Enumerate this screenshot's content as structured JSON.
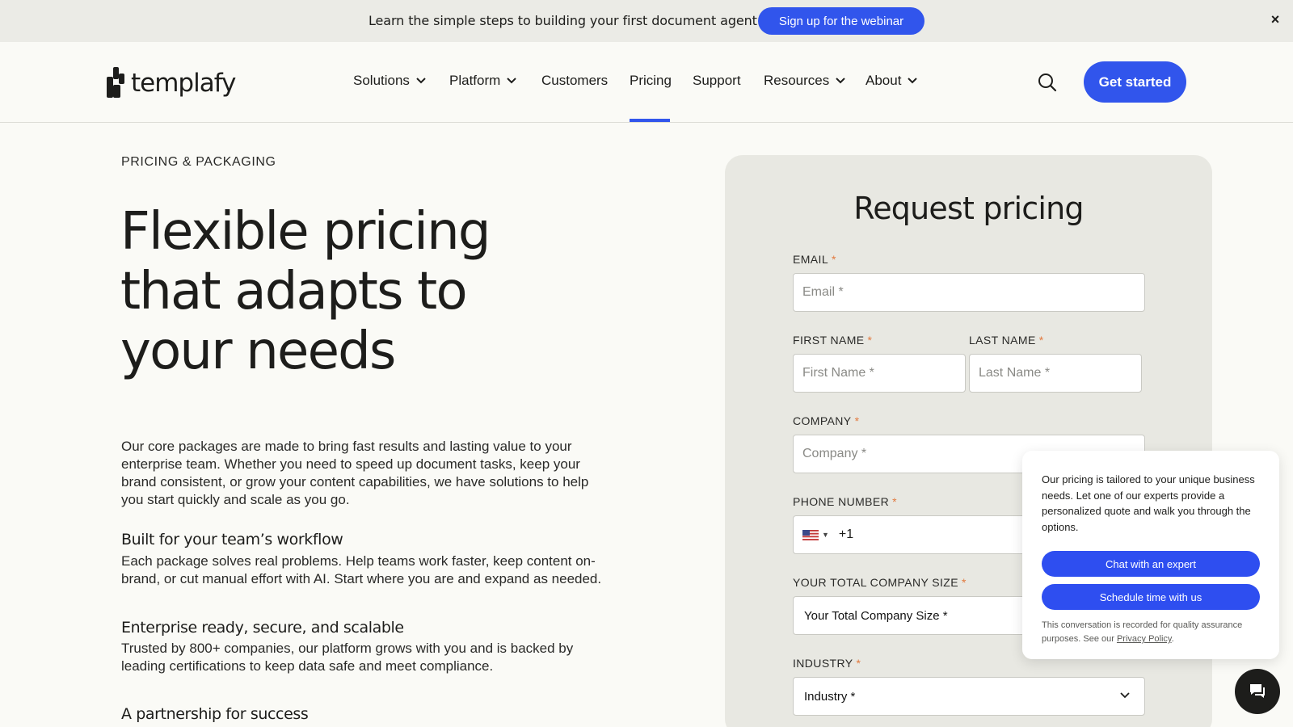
{
  "announcement": {
    "text": "Learn the simple steps to building your first document agent",
    "button_label": "Sign up for the webinar",
    "close_glyph": "×"
  },
  "header": {
    "logo_text": "templafy",
    "nav": [
      {
        "label": "Solutions",
        "has_dropdown": true
      },
      {
        "label": "Platform",
        "has_dropdown": true
      },
      {
        "label": "Customers",
        "has_dropdown": false
      },
      {
        "label": "Pricing",
        "has_dropdown": false,
        "active": true
      },
      {
        "label": "Support",
        "has_dropdown": false
      },
      {
        "label": "Resources",
        "has_dropdown": true
      },
      {
        "label": "About",
        "has_dropdown": true
      }
    ],
    "search_icon": "search-icon",
    "cta_label": "Get started"
  },
  "main": {
    "eyebrow": "PRICING & PACKAGING",
    "hero_line1": "Flexible pricing",
    "hero_line2": "that adapts to",
    "hero_line3": "your needs",
    "intro": "Our core packages are made to bring fast results and lasting value to your enterprise team. Whether you need to speed up document tasks, keep your brand consistent, or grow your content capabilities, we have solutions to help you start quickly and scale as you go.",
    "features": [
      {
        "title": "Built for your team’s workflow",
        "body": "Each package solves real problems. Help teams work faster, keep content on-brand, or cut manual effort with AI. Start where you are and expand as needed."
      },
      {
        "title": "Enterprise ready, secure, and scalable",
        "body": "Trusted by 800+ companies, our platform grows with you and is backed by leading certifications to keep data safe and meet compliance."
      },
      {
        "title": "A partnership for success",
        "body": ""
      }
    ]
  },
  "form": {
    "title": "Request pricing",
    "required_mark": "*",
    "email": {
      "label": "EMAIL",
      "placeholder": "Email *"
    },
    "first_name": {
      "label": "FIRST NAME",
      "placeholder": "First Name *"
    },
    "last_name": {
      "label": "LAST NAME",
      "placeholder": "Last Name *"
    },
    "company": {
      "label": "COMPANY",
      "placeholder": "Company *"
    },
    "phone": {
      "label": "PHONE NUMBER",
      "dial_code": "+1",
      "country": "US"
    },
    "company_size": {
      "label": "YOUR TOTAL COMPANY SIZE",
      "value": "Your Total Company Size *"
    },
    "industry": {
      "label": "INDUSTRY",
      "value": "Industry *"
    }
  },
  "chat_popover": {
    "message": "Our pricing is tailored to your unique business needs. Let one of our experts provide a personalized quote and walk you through the options.",
    "button1": "Chat with an expert",
    "button2": "Schedule time with us",
    "footer_prefix": "This conversation is recorded for quality assurance purposes. See our ",
    "footer_link": "Privacy Policy",
    "footer_suffix": "."
  },
  "colors": {
    "accent": "#3155ec",
    "required": "#e27a3f",
    "page_bg": "#fafaf6",
    "card_bg": "#e8e8e2"
  }
}
